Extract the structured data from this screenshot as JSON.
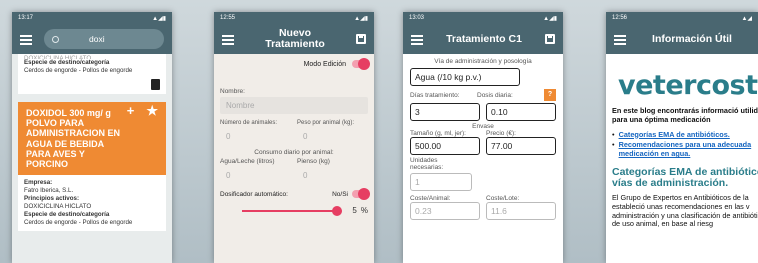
{
  "screens": {
    "s1": {
      "time": "13:17",
      "search_value": "doxi",
      "card_top": {
        "clipped_text": "DOXICICLINA HICLATO",
        "species_label": "Especie de destino/categoría",
        "species_value": "Cerdos de engorde - Pollos de engorde"
      },
      "card_orange": {
        "title": "DOXIDOL 300 mg/ g POLVO PARA ADMINISTRACION EN AGUA DE BEBIDA PARA AVES Y PORCINO",
        "add_glyph": "+",
        "fav_glyph": "★"
      },
      "card_detail": {
        "company_label": "Empresa:",
        "company_value": "Fatro Iberica, S.L.",
        "actives_label": "Principios activos:",
        "actives_value": "DOXICICLINA HICLATO",
        "species_label": "Especie de destino/categoría",
        "species_value": "Cerdos de engorde - Pollos de engorde"
      }
    },
    "s2": {
      "time": "12:55",
      "title": "Nuevo Tratamiento",
      "edit_mode_label": "Modo Edición",
      "name_label": "Nombre:",
      "name_placeholder": "Nombre",
      "animals_label": "Número de animales:",
      "animals_value": "0",
      "weight_label": "Peso por animal (kg):",
      "weight_value": "0",
      "consumption_label": "Consumo diario por animal:",
      "water_label": "Agua/Leche (litros)",
      "water_value": "0",
      "feed_label": "Pienso (kg)",
      "feed_value": "0",
      "dispenser_label": "Dosificador automático:",
      "dispenser_toggle": "No/Si",
      "slider_value": "5",
      "slider_unit": "%",
      "slider_fraction": 0.95
    },
    "s3": {
      "time": "13:03",
      "title": "Tratamiento C1",
      "route_label": "Vía de administración y posología",
      "route_value": "Agua (/10 kg p.v.)",
      "days_label": "Días tratamiento:",
      "days_value": "3",
      "dose_label": "Dosis diaria:",
      "dose_value": "0.10",
      "help_glyph": "?",
      "package_label": "Envase",
      "size_label": "Tamaño (g, ml, jer):",
      "size_value": "500.00",
      "price_label": "Precio (€):",
      "price_value": "77.00",
      "units_label": "Unidades necesarias:",
      "units_value": "1",
      "cost_animal_label": "Coste/Animal:",
      "cost_animal_value": "0.23",
      "cost_lot_label": "Coste/Lote:",
      "cost_lot_value": "11.6"
    },
    "s4": {
      "time": "12:56",
      "title": "Información Útil",
      "logo": "vetercost",
      "intro": "En este blog encontrarás informació utilidad para una óptima medicación",
      "link1": "Categorías EMA de antibióticos.",
      "link2": "Recomendaciones para una adecuada medicación en agua.",
      "heading": "Categorías EMA de antibióticos vías de administración.",
      "para": "El Grupo de Expertos en Antibióticos de la estableció unas recomendaciones en las v administración y una clasificación de antibióticos de uso animal, en base al riesg"
    }
  },
  "colors": {
    "appbar": "#4a6670",
    "orange": "#ef8a33",
    "toggle": "#e63e62",
    "brand": "#2a7d8a"
  }
}
